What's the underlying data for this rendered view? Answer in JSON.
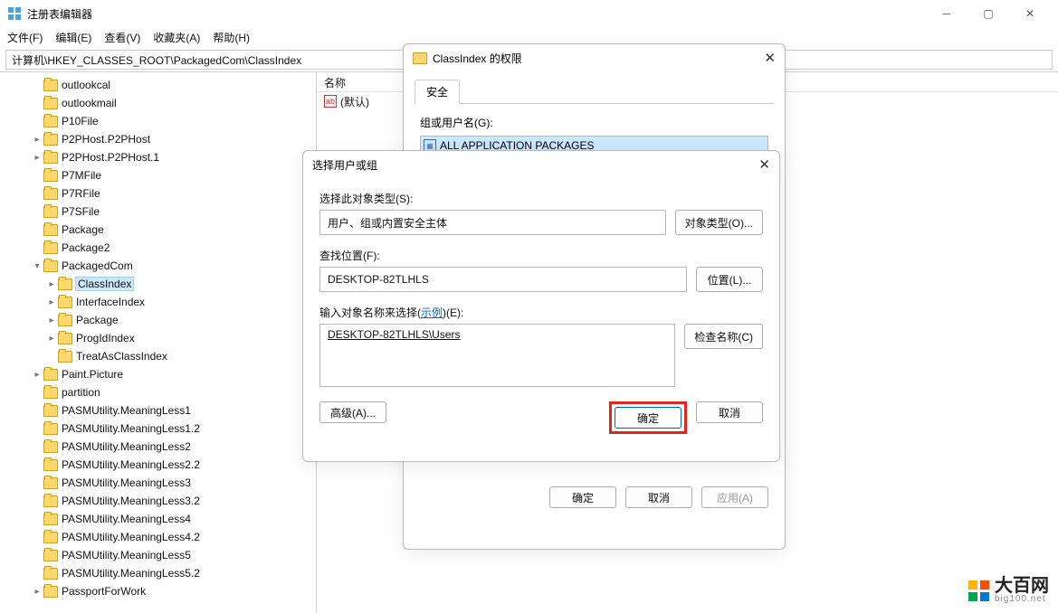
{
  "window": {
    "title": "注册表编辑器"
  },
  "menu": {
    "file": "文件(F)",
    "edit": "编辑(E)",
    "view": "查看(V)",
    "fav": "收藏夹(A)",
    "help": "帮助(H)"
  },
  "address": "计算机\\HKEY_CLASSES_ROOT\\PackagedCom\\ClassIndex",
  "tree": [
    {
      "ind": 2,
      "exp": "",
      "label": "outlookcal"
    },
    {
      "ind": 2,
      "exp": "",
      "label": "outlookmail"
    },
    {
      "ind": 2,
      "exp": "",
      "label": "P10File"
    },
    {
      "ind": 2,
      "exp": ">",
      "label": "P2PHost.P2PHost"
    },
    {
      "ind": 2,
      "exp": ">",
      "label": "P2PHost.P2PHost.1"
    },
    {
      "ind": 2,
      "exp": "",
      "label": "P7MFile"
    },
    {
      "ind": 2,
      "exp": "",
      "label": "P7RFile"
    },
    {
      "ind": 2,
      "exp": "",
      "label": "P7SFile"
    },
    {
      "ind": 2,
      "exp": "",
      "label": "Package"
    },
    {
      "ind": 2,
      "exp": "",
      "label": "Package2"
    },
    {
      "ind": 2,
      "exp": "v",
      "label": "PackagedCom"
    },
    {
      "ind": 3,
      "exp": ">",
      "label": "ClassIndex",
      "sel": true
    },
    {
      "ind": 3,
      "exp": ">",
      "label": "InterfaceIndex"
    },
    {
      "ind": 3,
      "exp": ">",
      "label": "Package"
    },
    {
      "ind": 3,
      "exp": ">",
      "label": "ProgIdIndex"
    },
    {
      "ind": 3,
      "exp": "",
      "label": "TreatAsClassIndex"
    },
    {
      "ind": 2,
      "exp": ">",
      "label": "Paint.Picture"
    },
    {
      "ind": 2,
      "exp": "",
      "label": "partition"
    },
    {
      "ind": 2,
      "exp": "",
      "label": "PASMUtility.MeaningLess1"
    },
    {
      "ind": 2,
      "exp": "",
      "label": "PASMUtility.MeaningLess1.2"
    },
    {
      "ind": 2,
      "exp": "",
      "label": "PASMUtility.MeaningLess2"
    },
    {
      "ind": 2,
      "exp": "",
      "label": "PASMUtility.MeaningLess2.2"
    },
    {
      "ind": 2,
      "exp": "",
      "label": "PASMUtility.MeaningLess3"
    },
    {
      "ind": 2,
      "exp": "",
      "label": "PASMUtility.MeaningLess3.2"
    },
    {
      "ind": 2,
      "exp": "",
      "label": "PASMUtility.MeaningLess4"
    },
    {
      "ind": 2,
      "exp": "",
      "label": "PASMUtility.MeaningLess4.2"
    },
    {
      "ind": 2,
      "exp": "",
      "label": "PASMUtility.MeaningLess5"
    },
    {
      "ind": 2,
      "exp": "",
      "label": "PASMUtility.MeaningLess5.2"
    },
    {
      "ind": 2,
      "exp": ">",
      "label": "PassportForWork"
    }
  ],
  "list": {
    "col_name": "名称",
    "default_row": "(默认)"
  },
  "perm": {
    "title": "ClassIndex 的权限",
    "tab": "安全",
    "groups_label": "组或用户名(G):",
    "group_row": "ALL APPLICATION PACKAGES",
    "ok": "确定",
    "cancel": "取消",
    "apply": "应用(A)"
  },
  "sel": {
    "title": "选择用户或组",
    "obj_label": "选择此对象类型(S):",
    "obj_value": "用户、组或内置安全主体",
    "obj_btn": "对象类型(O)...",
    "loc_label": "查找位置(F):",
    "loc_value": "DESKTOP-82TLHLS",
    "loc_btn": "位置(L)...",
    "name_label_pre": "输入对象名称来选择(",
    "name_label_link": "示例",
    "name_label_post": ")(E):",
    "name_value": "DESKTOP-82TLHLS\\Users",
    "check_btn": "检查名称(C)",
    "advanced": "高级(A)...",
    "ok": "确定",
    "cancel": "取消"
  },
  "watermark": {
    "big": "大百网",
    "small": "big100.net"
  }
}
